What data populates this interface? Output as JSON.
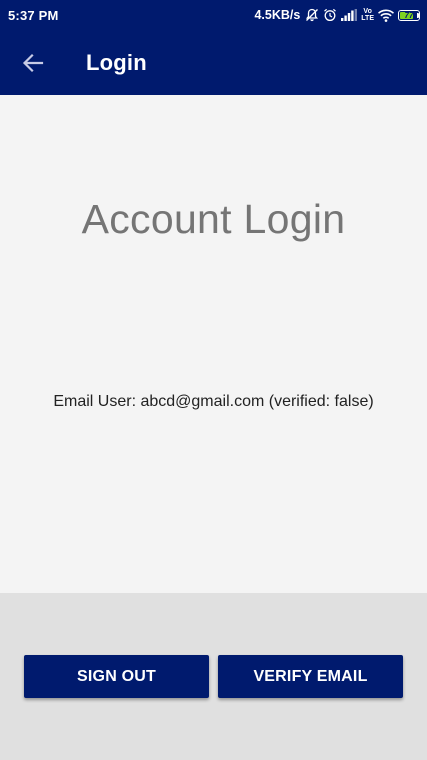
{
  "status_bar": {
    "time": "5:37 PM",
    "network_speed": "4.5KB/s",
    "lte_top": "Vo",
    "lte_bottom": "LTE",
    "battery_level": "77",
    "battery_fraction": 0.77,
    "icons": [
      "notifications-off-icon",
      "alarm-icon",
      "signal-icon",
      "volte-icon",
      "wifi-icon",
      "battery-icon"
    ]
  },
  "app_bar": {
    "title": "Login",
    "back_icon": "arrow-back-icon"
  },
  "main": {
    "heading": "Account Login",
    "user_status": "Email User: abcd@gmail.com (verified: false)"
  },
  "actions": {
    "sign_out_label": "SIGN OUT",
    "verify_email_label": "VERIFY EMAIL"
  },
  "colors": {
    "primary": "#001a6e",
    "background": "#f4f4f4",
    "bottom_panel": "#e0e0e0",
    "heading_text": "#757575",
    "battery_fill": "#7ed321"
  }
}
